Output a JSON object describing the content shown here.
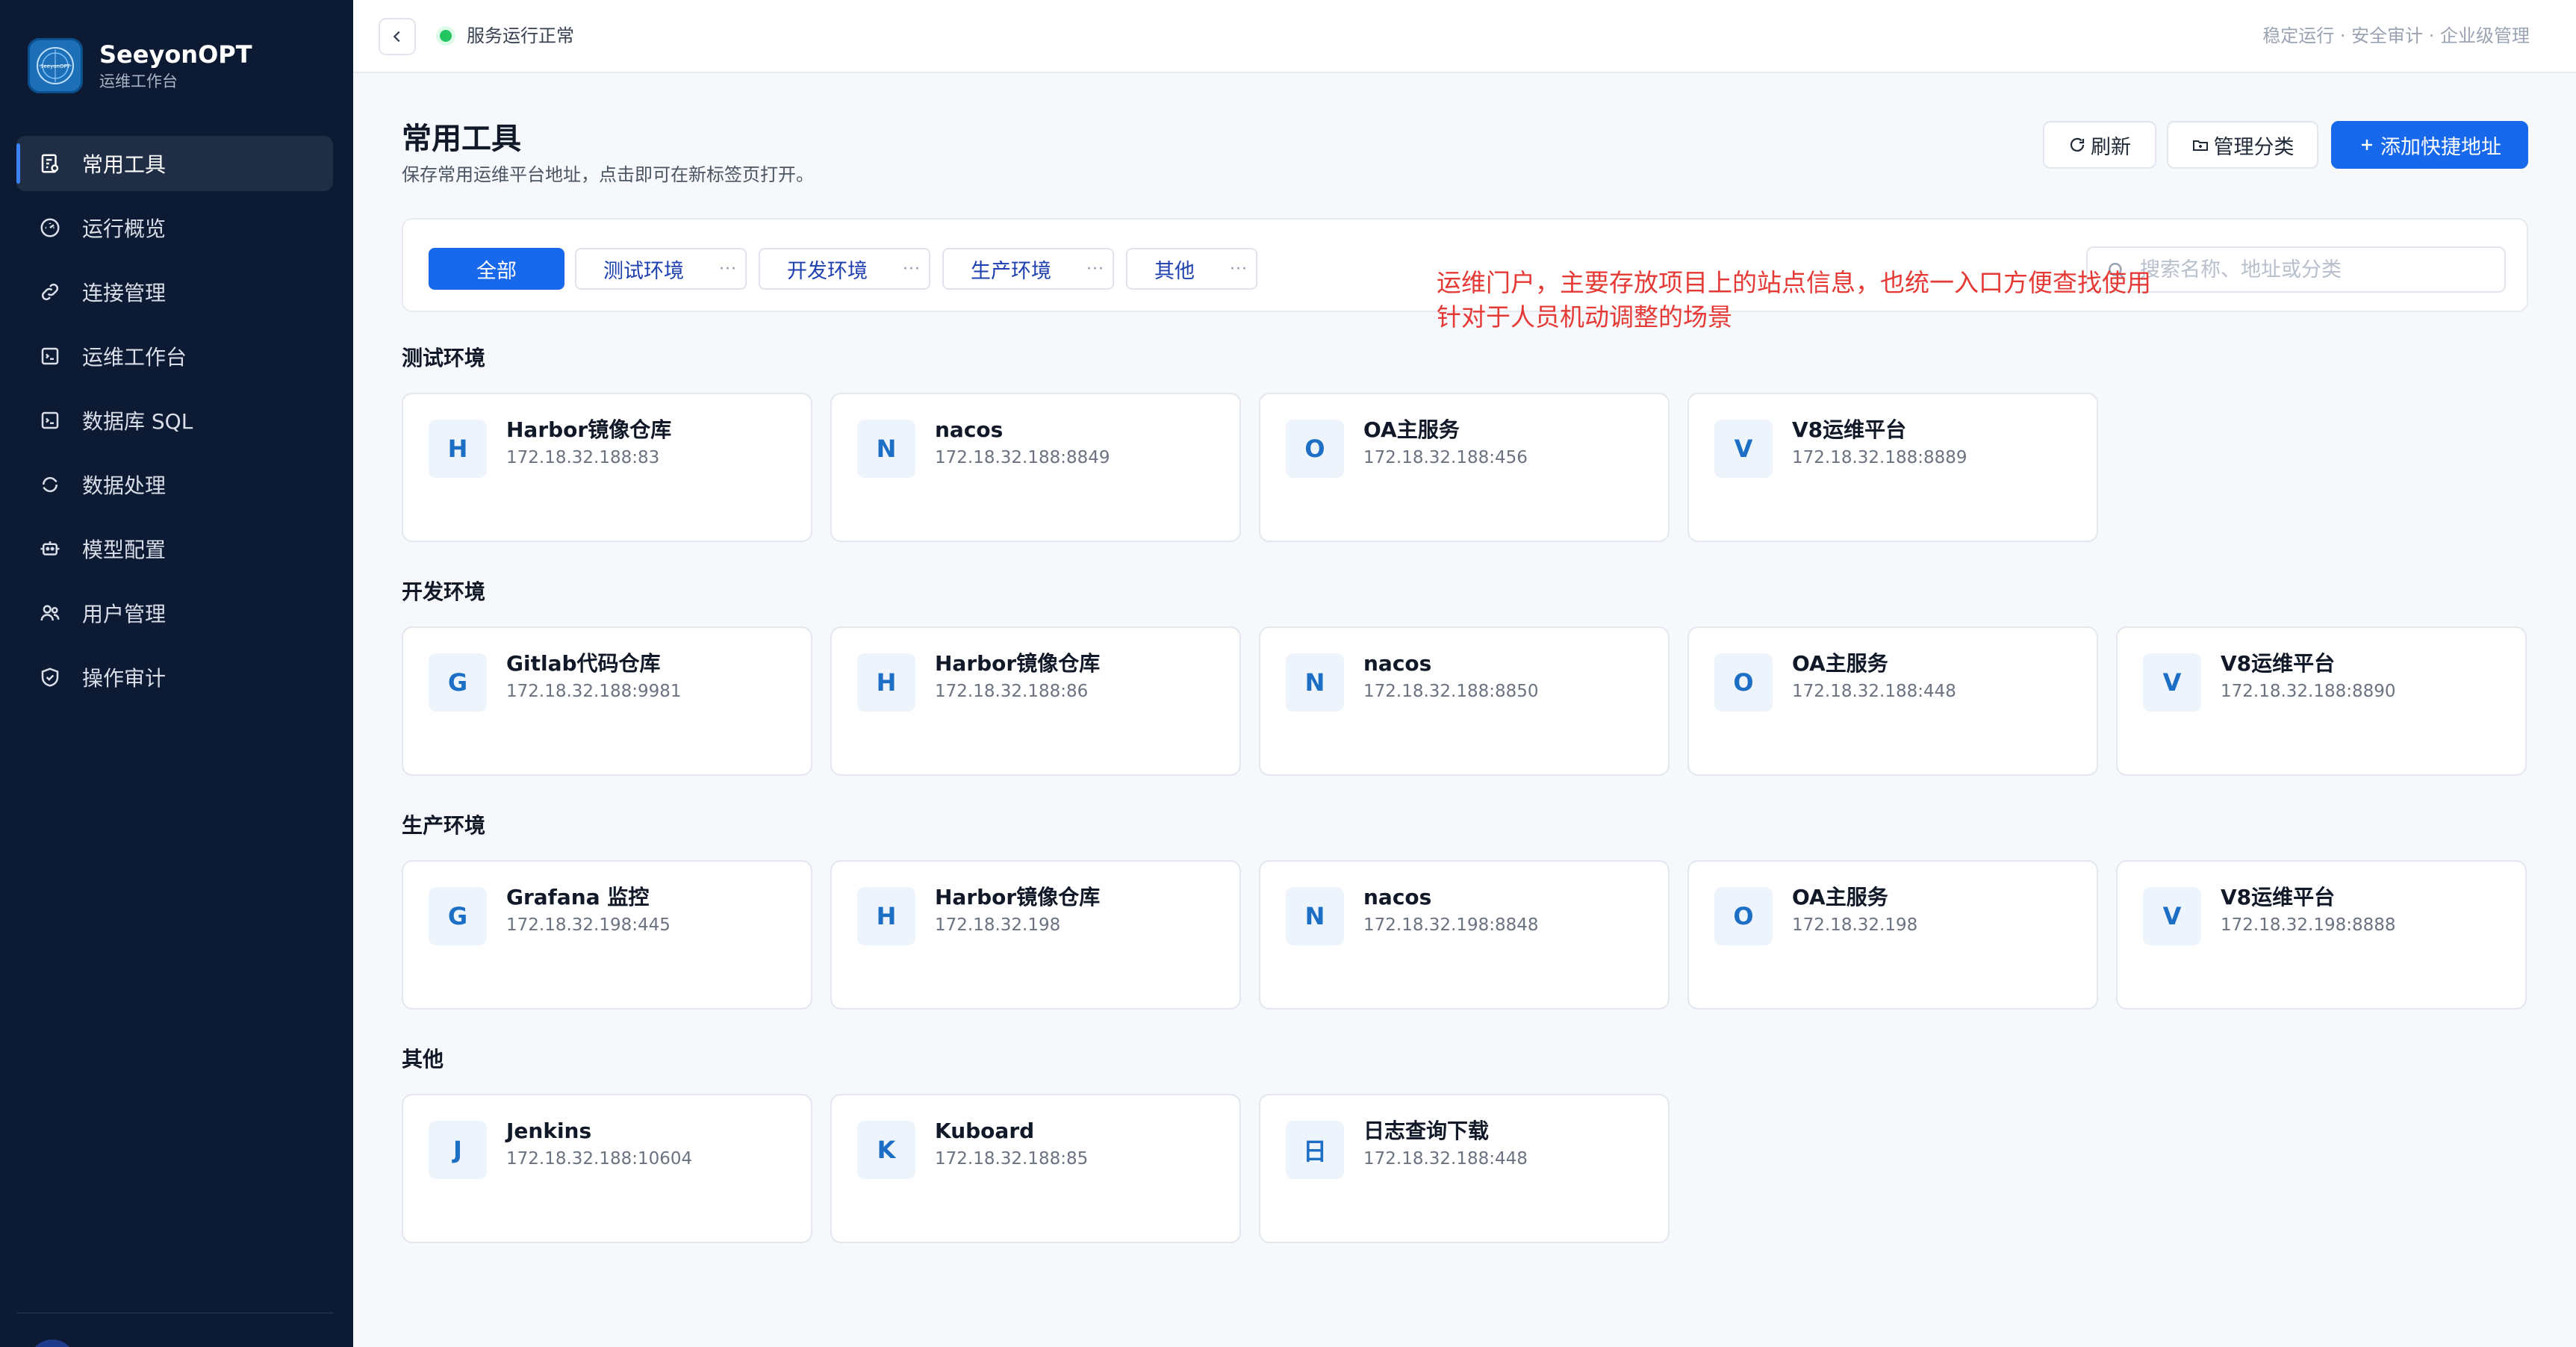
{
  "sidebar": {
    "brand_title": "SeeyonOPT",
    "brand_sub": "运维工作台",
    "logo_text": "SeeyonOPT",
    "items": [
      {
        "label": "常用工具",
        "icon": "tools-icon",
        "active": true
      },
      {
        "label": "运行概览",
        "icon": "dashboard-icon"
      },
      {
        "label": "连接管理",
        "icon": "link-icon"
      },
      {
        "label": "运维工作台",
        "icon": "terminal-icon"
      },
      {
        "label": "数据库 SQL",
        "icon": "database-icon"
      },
      {
        "label": "数据处理",
        "icon": "refresh-cycle-icon"
      },
      {
        "label": "模型配置",
        "icon": "robot-icon"
      },
      {
        "label": "用户管理",
        "icon": "users-icon"
      },
      {
        "label": "操作审计",
        "icon": "shield-icon"
      }
    ]
  },
  "topbar": {
    "status": "服务运行正常",
    "tagline": "稳定运行 · 安全审计 · 企业级管理"
  },
  "header": {
    "title": "常用工具",
    "subtitle": "保存常用运维平台地址，点击即可在新标签页打开。",
    "refresh_label": "刷新",
    "manage_label": "管理分类",
    "add_label": "添加快捷地址"
  },
  "filters": {
    "chips": [
      "全部",
      "测试环境",
      "开发环境",
      "生产环境",
      "其他"
    ],
    "more": "···",
    "search_placeholder": "搜索名称、地址或分类"
  },
  "annotation": {
    "line1": "运维门户，主要存放项目上的站点信息，也统一入口方便查找使用",
    "line2": "针对于人员机动调整的场景"
  },
  "sections": [
    {
      "title": "测试环境",
      "cards": [
        {
          "badge": "H",
          "name": "Harbor镜像仓库",
          "addr": "172.18.32.188:83"
        },
        {
          "badge": "N",
          "name": "nacos",
          "addr": "172.18.32.188:8849"
        },
        {
          "badge": "O",
          "name": "OA主服务",
          "addr": "172.18.32.188:456"
        },
        {
          "badge": "V",
          "name": "V8运维平台",
          "addr": "172.18.32.188:8889"
        }
      ]
    },
    {
      "title": "开发环境",
      "cards": [
        {
          "badge": "G",
          "name": "Gitlab代码仓库",
          "addr": "172.18.32.188:9981"
        },
        {
          "badge": "H",
          "name": "Harbor镜像仓库",
          "addr": "172.18.32.188:86"
        },
        {
          "badge": "N",
          "name": "nacos",
          "addr": "172.18.32.188:8850"
        },
        {
          "badge": "O",
          "name": "OA主服务",
          "addr": "172.18.32.188:448"
        },
        {
          "badge": "V",
          "name": "V8运维平台",
          "addr": "172.18.32.188:8890"
        }
      ]
    },
    {
      "title": "生产环境",
      "cards": [
        {
          "badge": "G",
          "name": "Grafana 监控",
          "addr": "172.18.32.198:445"
        },
        {
          "badge": "H",
          "name": "Harbor镜像仓库",
          "addr": "172.18.32.198"
        },
        {
          "badge": "N",
          "name": "nacos",
          "addr": "172.18.32.198:8848"
        },
        {
          "badge": "O",
          "name": "OA主服务",
          "addr": "172.18.32.198"
        },
        {
          "badge": "V",
          "name": "V8运维平台",
          "addr": "172.18.32.198:8888"
        }
      ]
    },
    {
      "title": "其他",
      "cards": [
        {
          "badge": "J",
          "name": "Jenkins",
          "addr": "172.18.32.188:10604"
        },
        {
          "badge": "K",
          "name": "Kuboard",
          "addr": "172.18.32.188:85"
        },
        {
          "badge": "日",
          "name": "日志查询下载",
          "addr": "172.18.32.188:448"
        }
      ]
    }
  ],
  "colors": {
    "sidebar_bg": "#0c1a33",
    "accent": "#1768ea",
    "status_ok": "#22c55e",
    "annotation": "#e53935",
    "badge_text": "#1c6fc4"
  }
}
